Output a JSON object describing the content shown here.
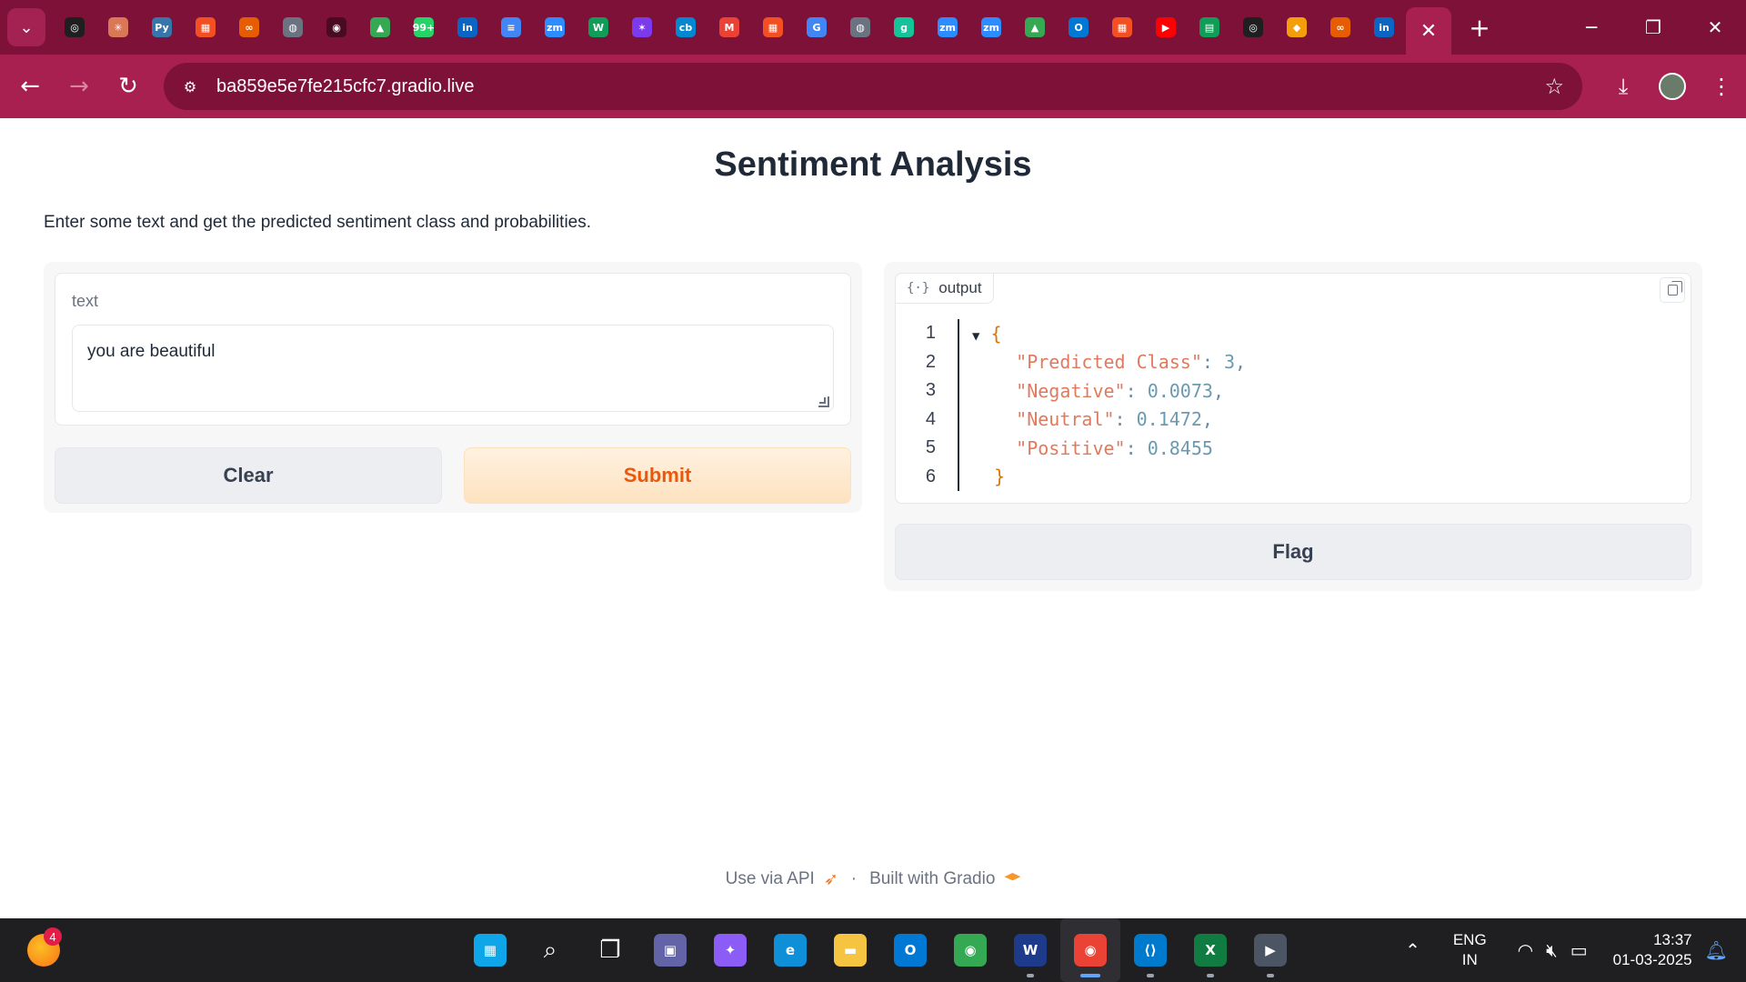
{
  "browser": {
    "url": "ba859e5e7fe215cfc7.gradio.live",
    "pinned_tabs": [
      {
        "name": "openai-tab",
        "glyph": "◎",
        "color": "#1f1f1f"
      },
      {
        "name": "claude-tab",
        "glyph": "✳",
        "color": "#d97757"
      },
      {
        "name": "python-tab",
        "glyph": "Py",
        "color": "#3776ab"
      },
      {
        "name": "microsoft-tab",
        "glyph": "▦",
        "color": "#f25022"
      },
      {
        "name": "coursera-tab",
        "glyph": "∞",
        "color": "#e65c00"
      },
      {
        "name": "globe-tab",
        "glyph": "◍",
        "color": "#6b7280"
      },
      {
        "name": "github-tab",
        "glyph": "◉",
        "color": "#4a0b22"
      },
      {
        "name": "drive-tab",
        "glyph": "▲",
        "color": "#34a853"
      },
      {
        "name": "whatsapp-tab",
        "glyph": "99+",
        "color": "#25d366"
      },
      {
        "name": "linkedin-tab",
        "glyph": "in",
        "color": "#0a66c2"
      },
      {
        "name": "docs-tab",
        "glyph": "≡",
        "color": "#4285f4"
      },
      {
        "name": "zoom-tab",
        "glyph": "zm",
        "color": "#2d8cff"
      },
      {
        "name": "wellfound-tab",
        "glyph": "W",
        "color": "#0f9d58"
      },
      {
        "name": "copilot-tab",
        "glyph": "✶",
        "color": "#7c3aed"
      },
      {
        "name": "crunchbase-tab",
        "glyph": "cb",
        "color": "#0288d1"
      },
      {
        "name": "gmail-tab",
        "glyph": "M",
        "color": "#ea4335"
      },
      {
        "name": "microsoft-tab-2",
        "glyph": "▦",
        "color": "#f25022"
      },
      {
        "name": "google-tab",
        "glyph": "G",
        "color": "#4285f4"
      },
      {
        "name": "globe-tab-2",
        "glyph": "◍",
        "color": "#6b7280"
      },
      {
        "name": "grammarly-tab",
        "glyph": "g",
        "color": "#15c39a"
      },
      {
        "name": "zoom-tab-2",
        "glyph": "zm",
        "color": "#2d8cff"
      },
      {
        "name": "zoom-tab-3",
        "glyph": "zm",
        "color": "#2d8cff"
      },
      {
        "name": "drive-tab-2",
        "glyph": "▲",
        "color": "#34a853"
      },
      {
        "name": "outlook-tab",
        "glyph": "O",
        "color": "#0078d4"
      },
      {
        "name": "microsoft-tab-3",
        "glyph": "▦",
        "color": "#f25022"
      },
      {
        "name": "youtube-tab",
        "glyph": "▶",
        "color": "#ff0000"
      },
      {
        "name": "sheets-tab",
        "glyph": "▤",
        "color": "#0f9d58"
      },
      {
        "name": "openai-tab-2",
        "glyph": "◎",
        "color": "#1f1f1f"
      },
      {
        "name": "box-tab",
        "glyph": "◆",
        "color": "#f59e0b"
      },
      {
        "name": "coursera-tab-2",
        "glyph": "∞",
        "color": "#e65c00"
      },
      {
        "name": "linkedin-tab-2",
        "glyph": "in",
        "color": "#0a66c2"
      }
    ],
    "active_tab_icon": "close-icon"
  },
  "app": {
    "title": "Sentiment Analysis",
    "description": "Enter some text and get the predicted sentiment class and probabilities.",
    "input": {
      "label": "text",
      "value": "you are beautiful"
    },
    "buttons": {
      "clear": "Clear",
      "submit": "Submit",
      "flag": "Flag"
    },
    "output": {
      "label": "output",
      "line_numbers": [
        "1",
        "2",
        "3",
        "4",
        "5",
        "6"
      ],
      "open_brace": "{",
      "close_brace": "}",
      "entries": [
        {
          "key": "\"Predicted Class\"",
          "value": "3",
          "comma": ","
        },
        {
          "key": "\"Negative\"",
          "value": "0.0073",
          "comma": ","
        },
        {
          "key": "\"Neutral\"",
          "value": "0.1472",
          "comma": ","
        },
        {
          "key": "\"Positive\"",
          "value": "0.8455",
          "comma": ""
        }
      ]
    },
    "footer": {
      "api": "Use via API",
      "separator": "·",
      "built_with": "Built with Gradio"
    }
  },
  "taskbar": {
    "weather_badge": "4",
    "apps": [
      {
        "name": "start-button",
        "glyph": "▦",
        "color": "#0ea5e9"
      },
      {
        "name": "search-button",
        "glyph": "⌕",
        "color": "transparent"
      },
      {
        "name": "task-view-button",
        "glyph": "❐",
        "color": "transparent"
      },
      {
        "name": "teams-app",
        "glyph": "▣",
        "color": "#6264a7"
      },
      {
        "name": "copilot-app",
        "glyph": "✦",
        "color": "#8b5cf6"
      },
      {
        "name": "edge-app",
        "glyph": "e",
        "color": "#0f8fd8"
      },
      {
        "name": "file-explorer-app",
        "glyph": "▬",
        "color": "#f5c542"
      },
      {
        "name": "outlook-app",
        "glyph": "O",
        "color": "#0078d4"
      },
      {
        "name": "chrome-app",
        "glyph": "◉",
        "color": "#34a853"
      },
      {
        "name": "webex-app",
        "glyph": "W",
        "color": "#1e3a8a"
      },
      {
        "name": "chrome-profile-app",
        "glyph": "◉",
        "color": "#ea4335"
      },
      {
        "name": "vscode-app",
        "glyph": "⟨⟩",
        "color": "#007acc"
      },
      {
        "name": "excel-app",
        "glyph": "X",
        "color": "#107c41"
      },
      {
        "name": "media-player-app",
        "glyph": "▶",
        "color": "#4b5563"
      }
    ],
    "lang_line1": "ENG",
    "lang_line2": "IN",
    "time": "13:37",
    "date": "01-03-2025"
  }
}
